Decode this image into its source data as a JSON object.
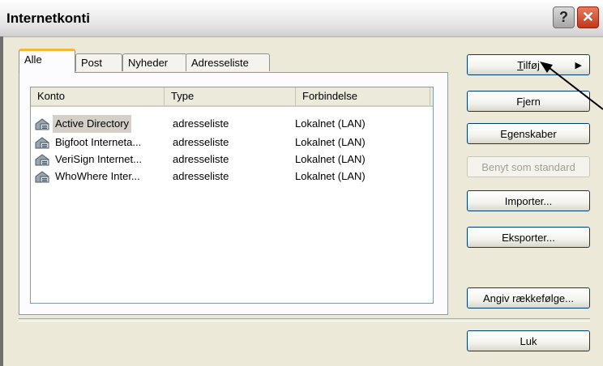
{
  "window": {
    "title": "Internetkonti"
  },
  "titlebar": {
    "help_glyph": "?",
    "close_glyph": "✕"
  },
  "tabs": [
    {
      "label": "Alle",
      "active": true
    },
    {
      "label": "Post",
      "active": false
    },
    {
      "label": "Nyheder",
      "active": false
    },
    {
      "label": "Adresseliste",
      "active": false
    }
  ],
  "columns": [
    "Konto",
    "Type",
    "Forbindelse"
  ],
  "accounts": [
    {
      "name": "Active Directory",
      "type": "adresseliste",
      "connection": "Lokalnet (LAN)",
      "selected": true,
      "icon": "directory-service-icon"
    },
    {
      "name": "Bigfoot Interneta...",
      "type": "adresseliste",
      "connection": "Lokalnet (LAN)",
      "selected": false,
      "icon": "directory-service-icon"
    },
    {
      "name": "VeriSign Internet...",
      "type": "adresseliste",
      "connection": "Lokalnet (LAN)",
      "selected": false,
      "icon": "directory-service-icon"
    },
    {
      "name": "WhoWhere Inter...",
      "type": "adresseliste",
      "connection": "Lokalnet (LAN)",
      "selected": false,
      "icon": "directory-service-icon"
    }
  ],
  "buttons": {
    "add": {
      "label_accel": "T",
      "label_rest": "ilføj",
      "submenu_glyph": "▶"
    },
    "remove": "Fjern",
    "properties": "Egenskaber",
    "set_default": "Benyt som standard",
    "import": "Importer...",
    "export": "Eksporter...",
    "set_order": "Angiv rækkefølge...",
    "close": "Luk"
  },
  "colors": {
    "face": "#ece9d8",
    "button_border": "#003c74",
    "tab_highlight": "#f7b732",
    "close_red": "#c2371c"
  }
}
